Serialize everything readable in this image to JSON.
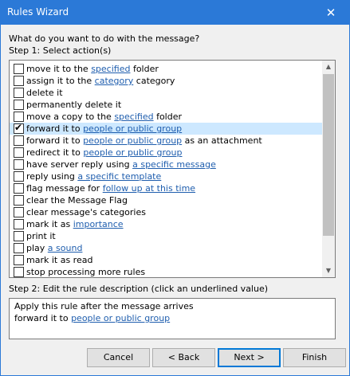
{
  "window": {
    "title": "Rules Wizard",
    "close_glyph": "✕"
  },
  "question": "What do you want to do with the message?",
  "step1_label": "Step 1: Select action(s)",
  "actions": [
    {
      "pre": "move it to the ",
      "link": "specified",
      "post": " folder",
      "checked": false
    },
    {
      "pre": "assign it to the ",
      "link": "category",
      "post": " category",
      "checked": false
    },
    {
      "pre": "delete it",
      "link": "",
      "post": "",
      "checked": false
    },
    {
      "pre": "permanently delete it",
      "link": "",
      "post": "",
      "checked": false
    },
    {
      "pre": "move a copy to the ",
      "link": "specified",
      "post": " folder",
      "checked": false
    },
    {
      "pre": "forward it to ",
      "link": "people or public group",
      "post": "",
      "checked": true,
      "selected": true
    },
    {
      "pre": "forward it to ",
      "link": "people or public group",
      "post": " as an attachment",
      "checked": false
    },
    {
      "pre": "redirect it to ",
      "link": "people or public group",
      "post": "",
      "checked": false
    },
    {
      "pre": "have server reply using ",
      "link": "a specific message",
      "post": "",
      "checked": false
    },
    {
      "pre": "reply using ",
      "link": "a specific template",
      "post": "",
      "checked": false
    },
    {
      "pre": "flag message for ",
      "link": "follow up at this time",
      "post": "",
      "checked": false
    },
    {
      "pre": "clear the Message Flag",
      "link": "",
      "post": "",
      "checked": false
    },
    {
      "pre": "clear message's categories",
      "link": "",
      "post": "",
      "checked": false
    },
    {
      "pre": "mark it as ",
      "link": "importance",
      "post": "",
      "checked": false
    },
    {
      "pre": "print it",
      "link": "",
      "post": "",
      "checked": false
    },
    {
      "pre": "play ",
      "link": "a sound",
      "post": "",
      "checked": false
    },
    {
      "pre": "mark it as read",
      "link": "",
      "post": "",
      "checked": false
    },
    {
      "pre": "stop processing more rules",
      "link": "",
      "post": "",
      "checked": false
    }
  ],
  "step2_label": "Step 2: Edit the rule description (click an underlined value)",
  "description": {
    "line1": "Apply this rule after the message arrives",
    "line2_pre": "forward it to ",
    "line2_link": "people or public group"
  },
  "buttons": {
    "cancel": "Cancel",
    "back": "< Back",
    "next": "Next >",
    "finish": "Finish"
  },
  "scrollbar": {
    "up_glyph": "▲",
    "down_glyph": "▼"
  },
  "check_glyph": "✔",
  "colors": {
    "titlebar": "#2b79d7",
    "link": "#1f5eae",
    "selection": "#cde8ff"
  }
}
